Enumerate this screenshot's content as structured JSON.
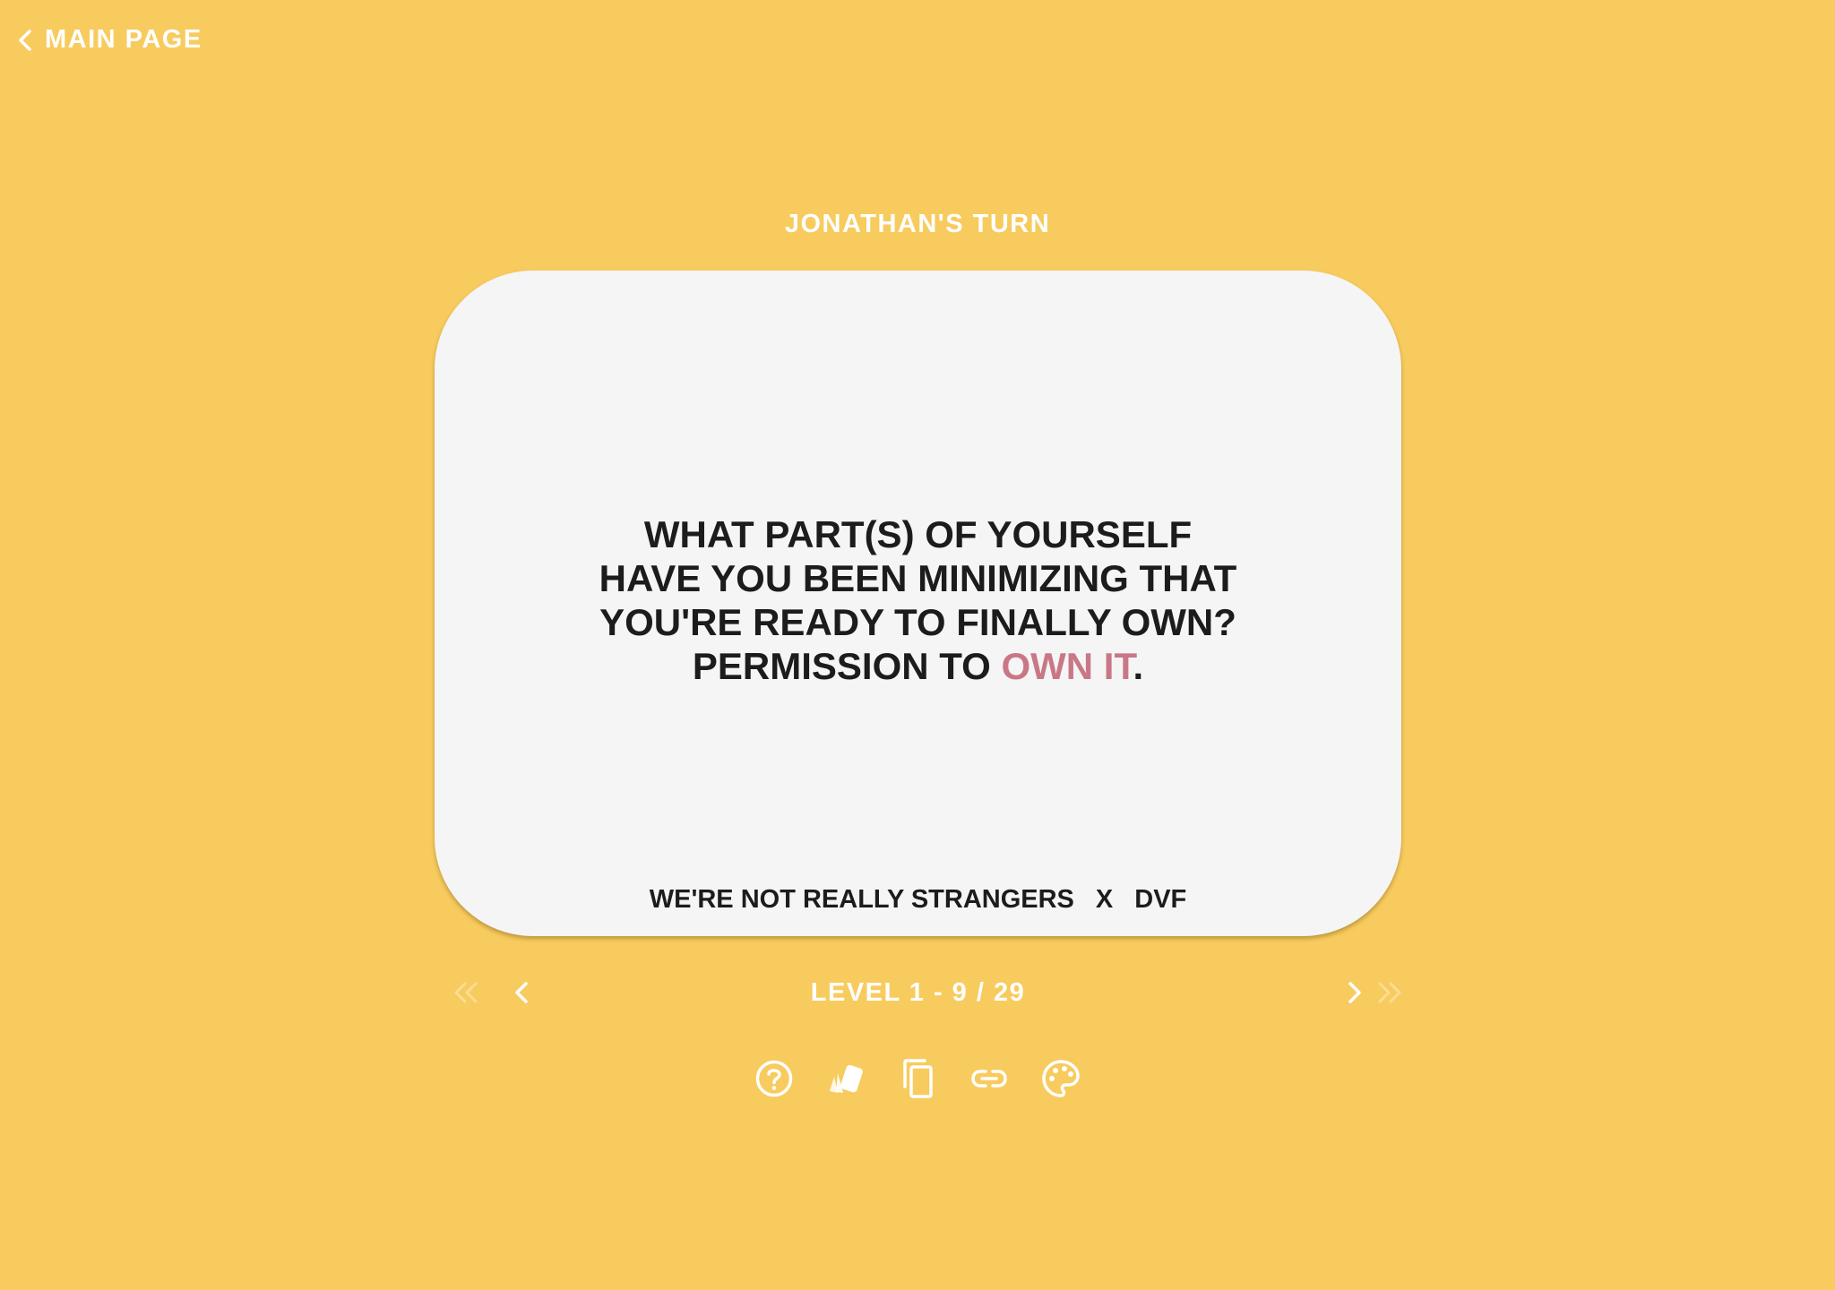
{
  "header": {
    "back_label": "MAIN PAGE"
  },
  "turn": {
    "label": "JONATHAN'S TURN"
  },
  "card": {
    "question_lines": [
      "WHAT PART(S) OF YOURSELF",
      "HAVE YOU BEEN MINIMIZING THAT",
      "YOU'RE READY TO FINALLY OWN?"
    ],
    "final_prefix": "PERMISSION TO ",
    "final_highlight": "OWN IT",
    "final_suffix": ".",
    "brand": "WE'RE NOT REALLY STRANGERS",
    "brand_separator": "X",
    "collab": "DVF"
  },
  "navigation": {
    "level_text": "LEVEL 1 - 9 / 29"
  },
  "toolbar": {
    "icons": [
      "help-icon",
      "cards-icon",
      "copy-icon",
      "link-icon",
      "palette-icon"
    ]
  },
  "colors": {
    "background": "#F8CB5E",
    "card": "#F5F5F5",
    "text": "#1C1C1C",
    "highlight": "#C97787",
    "accent_white": "#FFFFFF"
  }
}
